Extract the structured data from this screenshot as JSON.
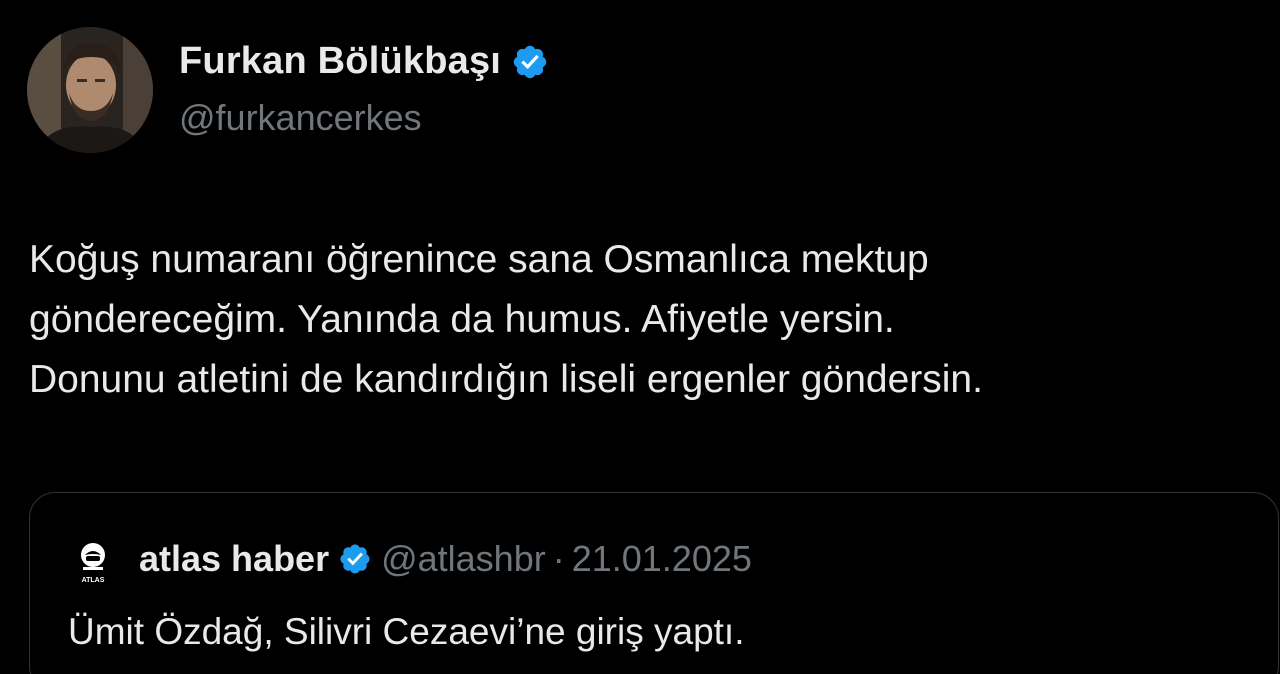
{
  "author": {
    "display_name": "Furkan Bölükbaşı",
    "handle": "@furkancerkes",
    "verified_icon": "verified-badge-icon"
  },
  "tweet": {
    "lines": [
      "Koğuş numaranı öğrenince sana Osmanlıca mektup",
      "göndereceğim. Yanında da humus. Afiyetle yersin.",
      "Donunu atletini de kandırdığın liseli ergenler göndersin."
    ]
  },
  "quoted": {
    "display_name": "atlas haber",
    "handle": "@atlashbr",
    "separator": "·",
    "date": "21.01.2025",
    "text": "Ümit Özdağ, Silivri Cezaevi’ne giriş yaptı.",
    "logo_text": "ATLAS"
  },
  "colors": {
    "background": "#000000",
    "text_primary": "#e7e9ea",
    "text_secondary": "#71767b",
    "verified_blue": "#1d9bf0",
    "border": "#2f3336"
  }
}
